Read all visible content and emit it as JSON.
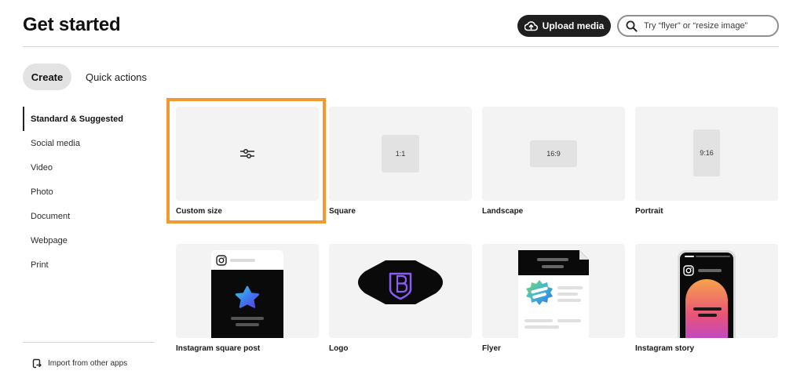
{
  "header": {
    "title": "Get started",
    "upload_label": "Upload media",
    "search_placeholder": "Try “flyer” or “resize image”"
  },
  "tabs": [
    {
      "label": "Create",
      "selected": true
    },
    {
      "label": "Quick actions",
      "selected": false
    }
  ],
  "sidebar": {
    "items": [
      {
        "label": "Standard & Suggested",
        "active": true
      },
      {
        "label": "Social media",
        "active": false
      },
      {
        "label": "Video",
        "active": false
      },
      {
        "label": "Photo",
        "active": false
      },
      {
        "label": "Document",
        "active": false
      },
      {
        "label": "Webpage",
        "active": false
      },
      {
        "label": "Print",
        "active": false
      }
    ],
    "import_label": "Import from other apps"
  },
  "templates": [
    {
      "label": "Custom size",
      "icon": "sliders-icon",
      "highlighted": true
    },
    {
      "label": "Square",
      "ratio": "1:1"
    },
    {
      "label": "Landscape",
      "ratio": "16:9"
    },
    {
      "label": "Portrait",
      "ratio": "9:16"
    },
    {
      "label": "Instagram square post",
      "icon": "instagram-icon"
    },
    {
      "label": "Logo",
      "icon": "logo-badge-icon"
    },
    {
      "label": "Flyer",
      "icon": "flyer-icon"
    },
    {
      "label": "Instagram story",
      "icon": "instagram-icon"
    }
  ],
  "colors": {
    "highlight": "#f29a32",
    "dark_button": "#1f1f1f",
    "tile_bg": "#f3f3f3",
    "logo_purple": "#8a5cf5"
  }
}
